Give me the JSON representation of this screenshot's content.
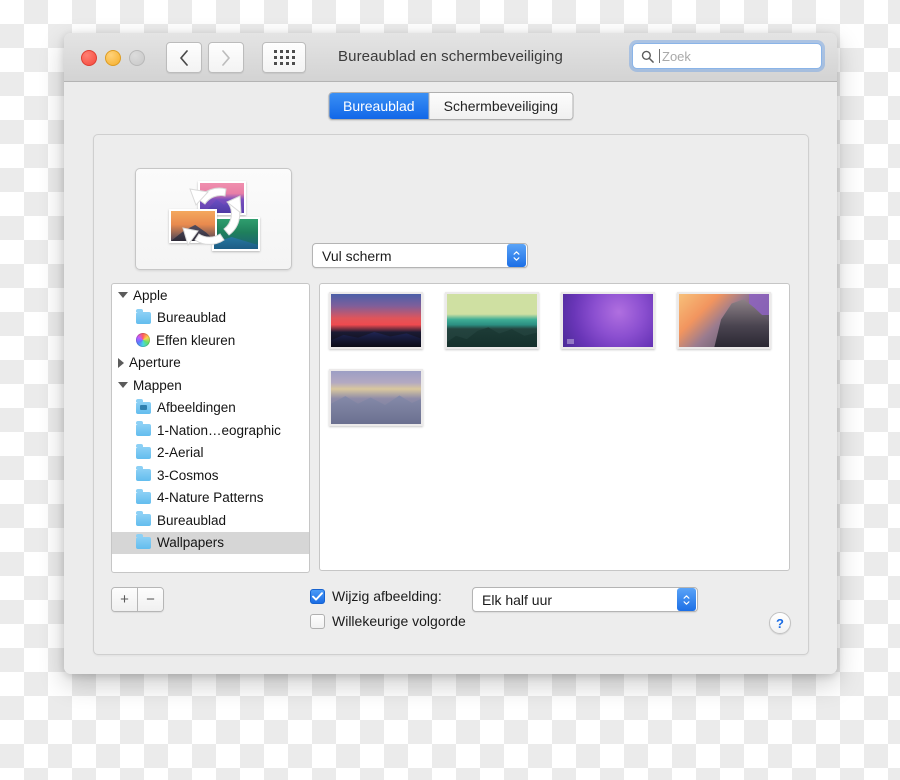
{
  "window": {
    "title": "Bureaublad en schermbeveiliging",
    "traffic_lights": [
      "close",
      "minimize",
      "zoom-disabled"
    ],
    "nav": {
      "back_icon": "chevron-left-icon",
      "forward_icon": "chevron-right-icon",
      "grid_icon": "grid-dots-icon"
    },
    "search": {
      "placeholder": "Zoek",
      "value": "",
      "icon": "search-icon"
    }
  },
  "tabs": [
    {
      "label": "Bureaublad",
      "active": true
    },
    {
      "label": "Schermbeveiliging",
      "active": false
    }
  ],
  "preview": {
    "name": "desktop-preview-rotating-wallpapers"
  },
  "scale_popup": {
    "value": "Vul scherm"
  },
  "source_list": {
    "items": [
      {
        "label": "Apple",
        "type": "group",
        "expanded": true,
        "indent": 0
      },
      {
        "label": "Bureaublad",
        "type": "folder",
        "indent": 1
      },
      {
        "label": "Effen kleuren",
        "type": "colorwheel",
        "indent": 1
      },
      {
        "label": "Aperture",
        "type": "group",
        "expanded": false,
        "indent": 0
      },
      {
        "label": "Mappen",
        "type": "group",
        "expanded": true,
        "indent": 0
      },
      {
        "label": "Afbeeldingen",
        "type": "folder-camera",
        "indent": 1
      },
      {
        "label": "1-Nation…eographic",
        "type": "folder",
        "indent": 1
      },
      {
        "label": "2-Aerial",
        "type": "folder",
        "indent": 1
      },
      {
        "label": "3-Cosmos",
        "type": "folder",
        "indent": 1
      },
      {
        "label": "4-Nature Patterns",
        "type": "folder",
        "indent": 1
      },
      {
        "label": "Bureaublad",
        "type": "folder",
        "indent": 1
      },
      {
        "label": "Wallpapers",
        "type": "folder",
        "indent": 1,
        "selected": true
      }
    ]
  },
  "thumbnails": [
    {
      "name": "wallpaper-sunset-ridge",
      "style": "t1"
    },
    {
      "name": "wallpaper-green-mountain",
      "style": "t2"
    },
    {
      "name": "wallpaper-purple-gradient",
      "style": "t3"
    },
    {
      "name": "wallpaper-yosemite-half-dome",
      "style": "t4"
    },
    {
      "name": "wallpaper-snow-peaks-dusk",
      "style": "t5"
    }
  ],
  "add_remove": {
    "add_label": "+",
    "remove_label": "−"
  },
  "change_image": {
    "label": "Wijzig afbeelding:",
    "checked": true
  },
  "interval_popup": {
    "value": "Elk half uur"
  },
  "random_order": {
    "label": "Willekeurige volgorde",
    "checked": false
  },
  "help": {
    "label": "?"
  }
}
